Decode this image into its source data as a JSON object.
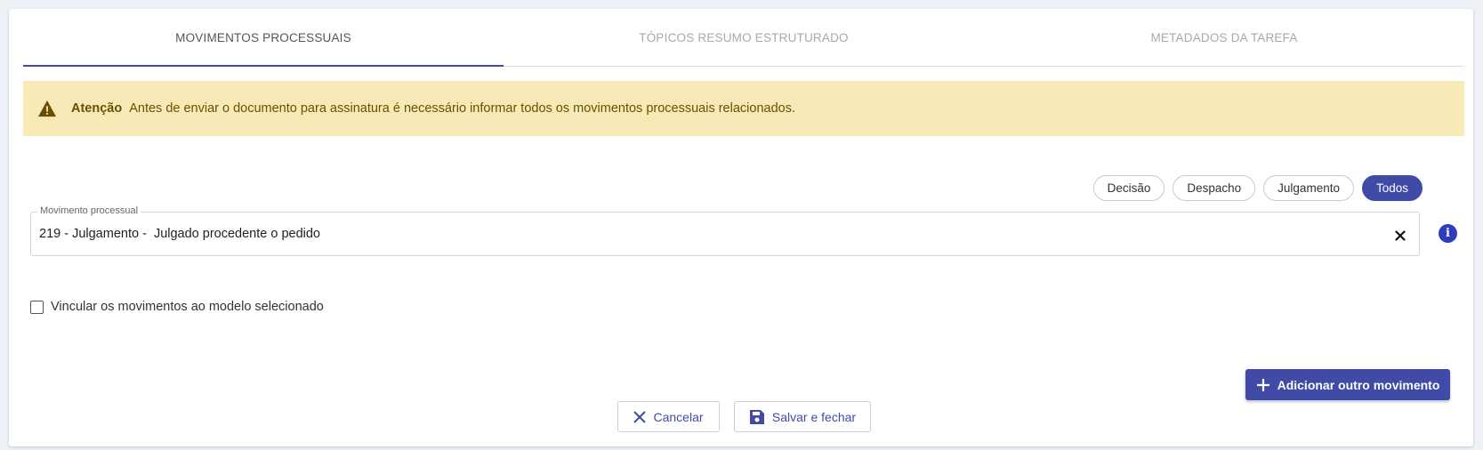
{
  "tabs": [
    {
      "label": "MOVIMENTOS PROCESSUAIS",
      "active": true
    },
    {
      "label": "TÓPICOS RESUMO ESTRUTURADO",
      "active": false
    },
    {
      "label": "METADADOS DA TAREFA",
      "active": false
    }
  ],
  "alert": {
    "title": "Atenção",
    "message": "Antes de enviar o documento para assinatura é necessário informar todos os movimentos processuais relacionados.",
    "icon": "warning-icon"
  },
  "filters": [
    {
      "label": "Decisão",
      "active": false
    },
    {
      "label": "Despacho",
      "active": false
    },
    {
      "label": "Julgamento",
      "active": false
    },
    {
      "label": "Todos",
      "active": true
    }
  ],
  "movement_field": {
    "label": "Movimento processual",
    "value": "219 - Julgamento -  Julgado procedente o pedido"
  },
  "info_icon": "i",
  "checkbox": {
    "label": "Vincular os movimentos ao modelo selecionado",
    "checked": false
  },
  "buttons": {
    "add": "Adicionar outro movimento",
    "cancel": "Cancelar",
    "save": "Salvar e fechar"
  },
  "colors": {
    "primary": "#3f4ba6",
    "alert_bg": "#f8eab7",
    "alert_text": "#6b4f00"
  }
}
